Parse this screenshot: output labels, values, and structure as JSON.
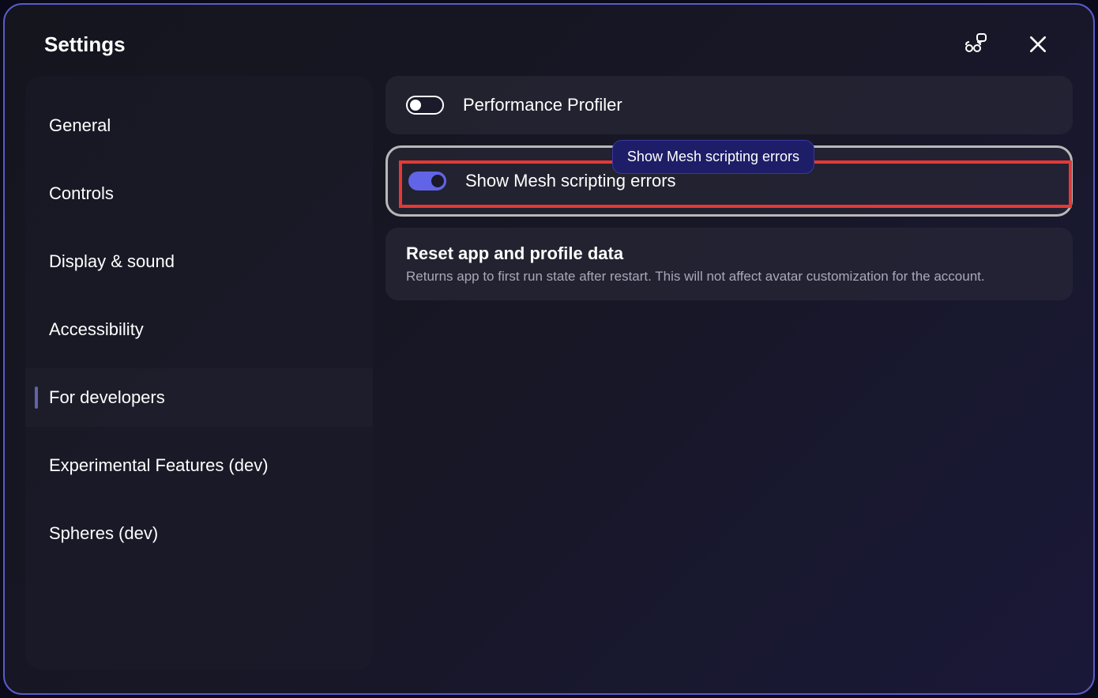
{
  "header": {
    "title": "Settings"
  },
  "sidebar": {
    "items": [
      {
        "label": "General",
        "active": false
      },
      {
        "label": "Controls",
        "active": false
      },
      {
        "label": "Display & sound",
        "active": false
      },
      {
        "label": "Accessibility",
        "active": false
      },
      {
        "label": "For developers",
        "active": true
      },
      {
        "label": "Experimental Features (dev)",
        "active": false
      },
      {
        "label": "Spheres (dev)",
        "active": false
      }
    ]
  },
  "settings": {
    "performanceProfiler": {
      "label": "Performance Profiler",
      "enabled": false
    },
    "meshScripting": {
      "label": "Show Mesh scripting errors",
      "enabled": true,
      "tooltip": "Show Mesh scripting errors"
    },
    "reset": {
      "title": "Reset app and profile data",
      "description": "Returns app to first run state after restart. This will not affect avatar customization for the account."
    }
  }
}
